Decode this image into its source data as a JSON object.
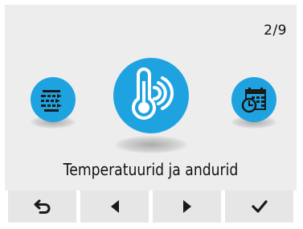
{
  "header": {
    "page_indicator": "2/9"
  },
  "menu": {
    "items": [
      {
        "icon": "list-arrows-icon"
      },
      {
        "icon": "thermometer-signal-icon"
      },
      {
        "icon": "calendar-clock-icon"
      }
    ],
    "selected_label": "Temperatuurid ja andurid"
  },
  "toolbar": {
    "buttons": [
      {
        "icon": "back-return-icon"
      },
      {
        "icon": "arrow-left-icon"
      },
      {
        "icon": "arrow-right-icon"
      },
      {
        "icon": "checkmark-icon"
      }
    ]
  },
  "colors": {
    "accent": "#1fa3e0",
    "background": "#ededed",
    "button": "#e6e6e6",
    "text": "#111111"
  }
}
